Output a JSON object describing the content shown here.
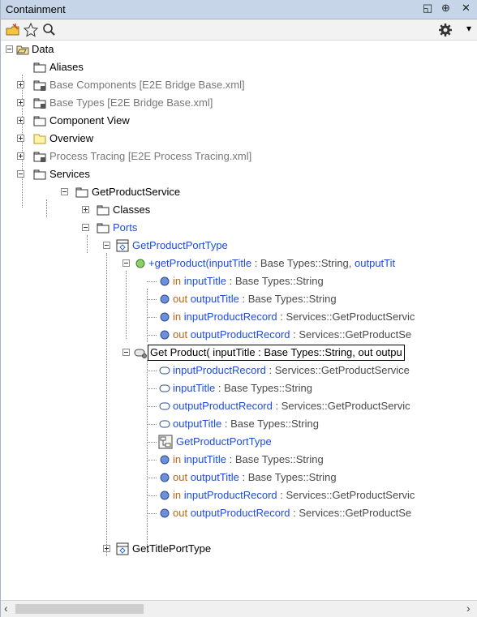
{
  "panel": {
    "title": "Containment",
    "ctrl_restore": "◱",
    "ctrl_pin": "⊕",
    "ctrl_close": "✕"
  },
  "toolbar": {
    "add_icon": "add-element-icon",
    "fav_icon": "star-icon",
    "search_icon": "search-icon",
    "settings_icon": "gear-icon",
    "dropdown": "▾"
  },
  "tree": {
    "data": "Data",
    "aliases": "Aliases",
    "base_components": "Base Components [E2E Bridge Base.xml]",
    "base_types": "Base Types [E2E Bridge Base.xml]",
    "component_view": "Component View",
    "overview": "Overview",
    "process_tracing": "Process Tracing [E2E Process Tracing.xml]",
    "services": "Services",
    "get_product_service": "GetProductService",
    "classes": "Classes",
    "ports": "Ports",
    "get_product_port_type": "GetProductPortType",
    "op_get_product": {
      "name": "+getProduct(",
      "p1": "inputTitle",
      "p1type": " : Base Types::String, ",
      "p2": "outputTit"
    },
    "op_params": [
      {
        "dir": "in ",
        "name": "inputTitle",
        "type": " : Base Types::String"
      },
      {
        "dir": "out ",
        "name": "outputTitle",
        "type": " : Base Types::String"
      },
      {
        "dir": "in ",
        "name": "inputProductRecord",
        "type": " : Services::GetProductServic"
      },
      {
        "dir": "out ",
        "name": "outputProductRecord",
        "type": " : Services::GetProductSe"
      }
    ],
    "edit_value": "Get Product( inputTitle : Base Types::String, out outpu",
    "attrs": [
      {
        "name": "inputProductRecord",
        "type": " : Services::GetProductService"
      },
      {
        "name": "inputTitle",
        "type": " : Base Types::String"
      },
      {
        "name": "outputProductRecord",
        "type": " : Services::GetProductServic"
      },
      {
        "name": "outputTitle",
        "type": " : Base Types::String"
      }
    ],
    "diagram": "GetProductPortType",
    "act_params": [
      {
        "dir": "in ",
        "name": "inputTitle",
        "type": " : Base Types::String"
      },
      {
        "dir": "out ",
        "name": "outputTitle",
        "type": " : Base Types::String"
      },
      {
        "dir": "in ",
        "name": "inputProductRecord",
        "type": " : Services::GetProductServic"
      },
      {
        "dir": "out ",
        "name": "outputProductRecord",
        "type": " : Services::GetProductSe"
      }
    ],
    "get_title_port_type": "GetTitlePortType"
  },
  "scroll": {
    "left": "‹",
    "right": "›"
  }
}
